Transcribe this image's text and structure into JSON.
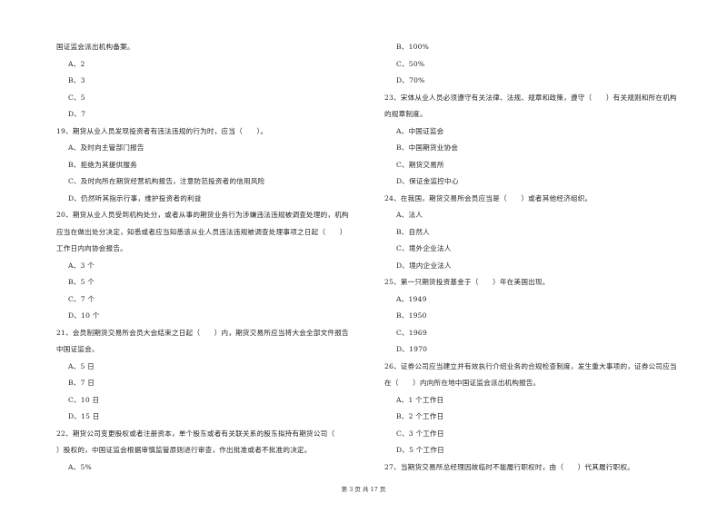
{
  "page": {
    "footer": "第 3 页 共 17 页"
  },
  "left_column": [
    {
      "type": "text",
      "text": "国证监会派出机构备案。"
    },
    {
      "type": "option",
      "text": "A、2"
    },
    {
      "type": "option",
      "text": "B、3"
    },
    {
      "type": "option",
      "text": "C、5"
    },
    {
      "type": "option",
      "text": "D、7"
    },
    {
      "type": "text",
      "text": "19、期货从业人员发现投资者有违法违规的行为时，应当（　　）。"
    },
    {
      "type": "option",
      "text": "A、及时向主管部门报告"
    },
    {
      "type": "option",
      "text": "B、拒绝为其提供服务"
    },
    {
      "type": "option",
      "text": "C、及时向所在期货经营机构报告，注意防范投资者的信用风险"
    },
    {
      "type": "option",
      "text": "D、仍然听其指示行事，维护投资者的利益"
    },
    {
      "type": "text",
      "text": "20、期货从业人员受到机构处分，或者从事的期货业务行为涉嫌违法违规被调查处理的，机构"
    },
    {
      "type": "text",
      "text": "应当在做出处分决定，知悉或者应当知悉该从业人员违法违规被调查处理事项之日起（　　）"
    },
    {
      "type": "text",
      "text": "工作日内向协会报告。"
    },
    {
      "type": "option",
      "text": "A、3 个"
    },
    {
      "type": "option",
      "text": "B、5 个"
    },
    {
      "type": "option",
      "text": "C、7 个"
    },
    {
      "type": "option",
      "text": "D、10 个"
    },
    {
      "type": "text",
      "text": "21、会员制期货交易所会员大会结束之日起（　　）内，期货交易所应当将大会全部文件报告"
    },
    {
      "type": "text",
      "text": "中国证监会。"
    },
    {
      "type": "option",
      "text": "A、5 日"
    },
    {
      "type": "option",
      "text": "B、7 日"
    },
    {
      "type": "option",
      "text": "C、10 日"
    },
    {
      "type": "option",
      "text": "D、15 日"
    },
    {
      "type": "text",
      "text": "22、期货公司变更股权或者注册资本，单个股东或者有关联关系的股东拟持有期货公司（"
    },
    {
      "type": "text",
      "text": "）股权的，中国证监会根据审慎监管原则进行审查，作出批准或者不批准的决定。"
    },
    {
      "type": "option",
      "text": "A、5%"
    }
  ],
  "right_column": [
    {
      "type": "option",
      "text": "B、100%"
    },
    {
      "type": "option",
      "text": "C、50%"
    },
    {
      "type": "option",
      "text": "D、70%"
    },
    {
      "type": "text",
      "text": "23、宋体从业人员必须遵守有关法律、法规、规章和政策，遵守（　　）有关规则和所在机构"
    },
    {
      "type": "text",
      "text": "的规章制度。"
    },
    {
      "type": "option",
      "text": "A、中国证监会"
    },
    {
      "type": "option",
      "text": "B、中国期货业协会"
    },
    {
      "type": "option",
      "text": "C、期货交易所"
    },
    {
      "type": "option",
      "text": "D、保证金监控中心"
    },
    {
      "type": "text",
      "text": "24、在我国，期货交易所会员应当是（　　）或者其他经济组织。"
    },
    {
      "type": "option",
      "text": "A、法人"
    },
    {
      "type": "option",
      "text": "B、自然人"
    },
    {
      "type": "option",
      "text": "C、境外企业法人"
    },
    {
      "type": "option",
      "text": "D、境内企业法人"
    },
    {
      "type": "text",
      "text": "25、第一只期货投资基金于（　　）年在美国出现。"
    },
    {
      "type": "option",
      "text": "A、1949"
    },
    {
      "type": "option",
      "text": "B、1950"
    },
    {
      "type": "option",
      "text": "C、1969"
    },
    {
      "type": "option",
      "text": "D、1970"
    },
    {
      "type": "text",
      "text": "26、证券公司应当建立并有效执行介绍业务的合规检查制度，发生重大事项的，证券公司应当"
    },
    {
      "type": "text",
      "text": "在（　　）内向所在地中国证监会派出机构报告。"
    },
    {
      "type": "option",
      "text": "A、1 个工作日"
    },
    {
      "type": "option",
      "text": "B、2 个工作日"
    },
    {
      "type": "option",
      "text": "C、3 个工作日"
    },
    {
      "type": "option",
      "text": "D、5 个工作日"
    },
    {
      "type": "text",
      "text": "27、当期货交易所总经理因故临时不能履行职权时，由（　　）代其履行职权。"
    }
  ]
}
